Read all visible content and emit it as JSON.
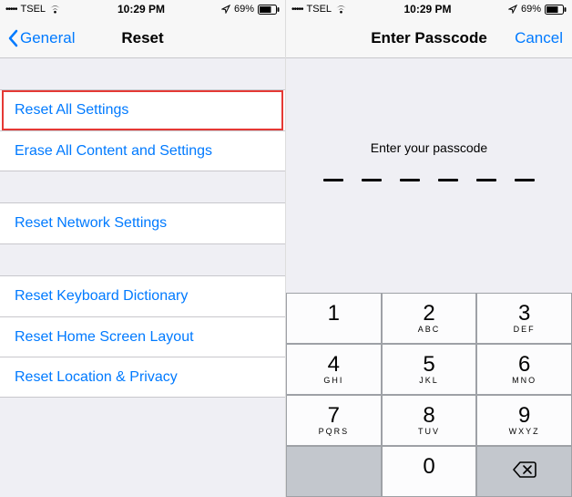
{
  "status": {
    "signal_dots": "•••••",
    "carrier": "TSEL",
    "time": "10:29 PM",
    "battery_pct": "69%"
  },
  "left": {
    "nav": {
      "back_label": "General",
      "title": "Reset"
    },
    "groups": [
      {
        "items": [
          {
            "label": "Reset All Settings",
            "highlight": true
          },
          {
            "label": "Erase All Content and Settings"
          }
        ]
      },
      {
        "items": [
          {
            "label": "Reset Network Settings"
          }
        ]
      },
      {
        "items": [
          {
            "label": "Reset Keyboard Dictionary"
          },
          {
            "label": "Reset Home Screen Layout"
          },
          {
            "label": "Reset Location & Privacy"
          }
        ]
      }
    ]
  },
  "right": {
    "nav": {
      "title": "Enter Passcode",
      "cancel_label": "Cancel"
    },
    "prompt": "Enter your passcode",
    "digits": 6,
    "keypad": [
      [
        {
          "n": "1",
          "s": ""
        },
        {
          "n": "2",
          "s": "ABC"
        },
        {
          "n": "3",
          "s": "DEF"
        }
      ],
      [
        {
          "n": "4",
          "s": "GHI"
        },
        {
          "n": "5",
          "s": "JKL"
        },
        {
          "n": "6",
          "s": "MNO"
        }
      ],
      [
        {
          "n": "7",
          "s": "PQRS"
        },
        {
          "n": "8",
          "s": "TUV"
        },
        {
          "n": "9",
          "s": "WXYZ"
        }
      ],
      [
        {
          "blank": true
        },
        {
          "n": "0",
          "s": ""
        },
        {
          "del": true
        }
      ]
    ]
  }
}
